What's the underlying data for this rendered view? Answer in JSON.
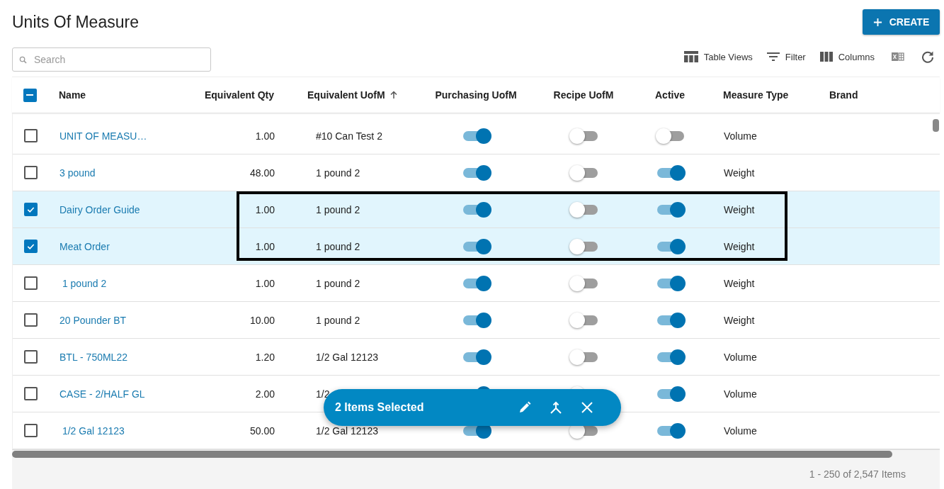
{
  "title": "Units Of Measure",
  "create_button": "CREATE",
  "search": {
    "placeholder": "Search"
  },
  "toolbar": [
    {
      "kind": "views",
      "label": "Table Views"
    },
    {
      "kind": "filter",
      "label": "Filter"
    },
    {
      "kind": "columns",
      "label": "Columns"
    },
    {
      "kind": "excel"
    },
    {
      "kind": "refresh"
    }
  ],
  "table": {
    "header_checkbox": {
      "checked": true
    },
    "columns": [
      {
        "label": "Name",
        "sorted": false
      },
      {
        "label": "Equivalent Qty",
        "sorted": false
      },
      {
        "label": "Equivalent UofM",
        "sorted": true
      },
      {
        "label": "Purchasing UofM",
        "sorted": false
      },
      {
        "label": "Recipe UofM",
        "sorted": false
      },
      {
        "label": "Active",
        "sorted": false
      },
      {
        "label": "Measure Type",
        "sorted": false
      },
      {
        "label": "Brand",
        "sorted": false
      }
    ],
    "rows": [
      {
        "selected": false,
        "name": "UNIT OF MEASU…",
        "qty": "1.00",
        "uofm": "#10 Can Test 2",
        "purchasing": true,
        "recipe": false,
        "active": false,
        "type": "Volume"
      },
      {
        "selected": false,
        "name": "3 pound",
        "qty": "48.00",
        "uofm": "1 pound 2",
        "purchasing": true,
        "recipe": false,
        "active": true,
        "type": "Weight"
      },
      {
        "selected": true,
        "name": "Dairy Order Guide",
        "qty": "1.00",
        "uofm": "1 pound 2",
        "purchasing": true,
        "recipe": false,
        "active": true,
        "type": "Weight"
      },
      {
        "selected": true,
        "name": "Meat Order",
        "qty": "1.00",
        "uofm": "1 pound 2",
        "purchasing": true,
        "recipe": false,
        "active": true,
        "type": "Weight"
      },
      {
        "selected": false,
        "name": " 1 pound 2",
        "qty": "1.00",
        "uofm": "1 pound 2",
        "purchasing": true,
        "recipe": false,
        "active": true,
        "type": "Weight"
      },
      {
        "selected": false,
        "name": "20 Pounder BT",
        "qty": "10.00",
        "uofm": "1 pound 2",
        "purchasing": true,
        "recipe": false,
        "active": true,
        "type": "Weight"
      },
      {
        "selected": false,
        "name": "BTL - 750ML22",
        "qty": "1.20",
        "uofm": "1/2 Gal 12123",
        "purchasing": true,
        "recipe": false,
        "active": true,
        "type": "Volume"
      },
      {
        "selected": false,
        "name": "CASE - 2/HALF GL",
        "qty": "2.00",
        "uofm": "1/2",
        "purchasing": true,
        "recipe": false,
        "active": true,
        "type": "Volume"
      },
      {
        "selected": false,
        "name": " 1/2 Gal 12123",
        "qty": "50.00",
        "uofm": "1/2 Gal 12123",
        "purchasing": true,
        "recipe": false,
        "active": true,
        "type": "Volume"
      }
    ]
  },
  "selection_bar": {
    "label": "2 Items Selected"
  },
  "footer": "1 - 250 of 2,547 Items"
}
